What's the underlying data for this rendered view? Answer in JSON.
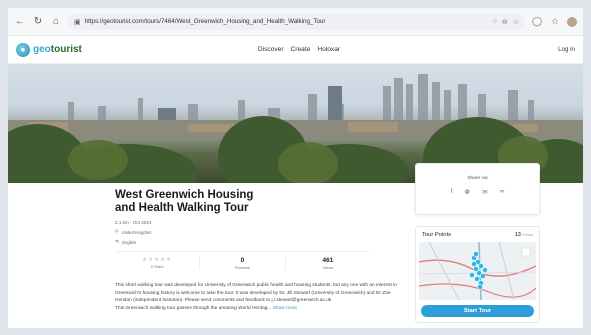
{
  "browser": {
    "url": "https://geotourist.com/tours/7464/West_Greenwich_Housing_and_Health_Walking_Tour"
  },
  "site": {
    "logo_geo": "geo",
    "logo_tourist": "tourist",
    "nav": [
      "Discover",
      "Create",
      "Holoxar"
    ],
    "login": "Log in"
  },
  "tour": {
    "title": "West Greenwich Housing and Health Walking Tour",
    "meta": "2.1 km · Oct 2024",
    "location": "United Kingdom",
    "language": "English",
    "stats": [
      {
        "value": "",
        "label": "0 Stars"
      },
      {
        "value": "0",
        "label": "Reviews"
      },
      {
        "value": "461",
        "label": "Views"
      }
    ],
    "description": "This short walking tour was developed for University of Greenwich public health and housing students, but any one with an interest in Greenwich's housing history is welcome to take the tour. It was developed by Dr. Jill Stewart (University of Greenwich) and Dr Zoe Hendon (independent historian). Please send comments and feedback to j.l.stewart@greenwich.ac.uk",
    "description_2": "This Greenwich walking tour passes through the amazing World Heritag...",
    "show_more": "Show more"
  },
  "share": {
    "label": "Share via"
  },
  "tour_points": {
    "heading": "Tour Points",
    "count": "13",
    "count_unit": "Points",
    "start_label": "Start Tour"
  },
  "icons": {
    "back": "back-arrow-icon",
    "reload": "reload-icon",
    "home": "home-icon",
    "lock": "lock-icon",
    "facebook": "facebook-icon",
    "twitter": "twitter-icon",
    "email": "email-icon",
    "link": "link-icon"
  },
  "colors": {
    "accent": "#2e9ed8",
    "marker": "#2bb9e8"
  }
}
